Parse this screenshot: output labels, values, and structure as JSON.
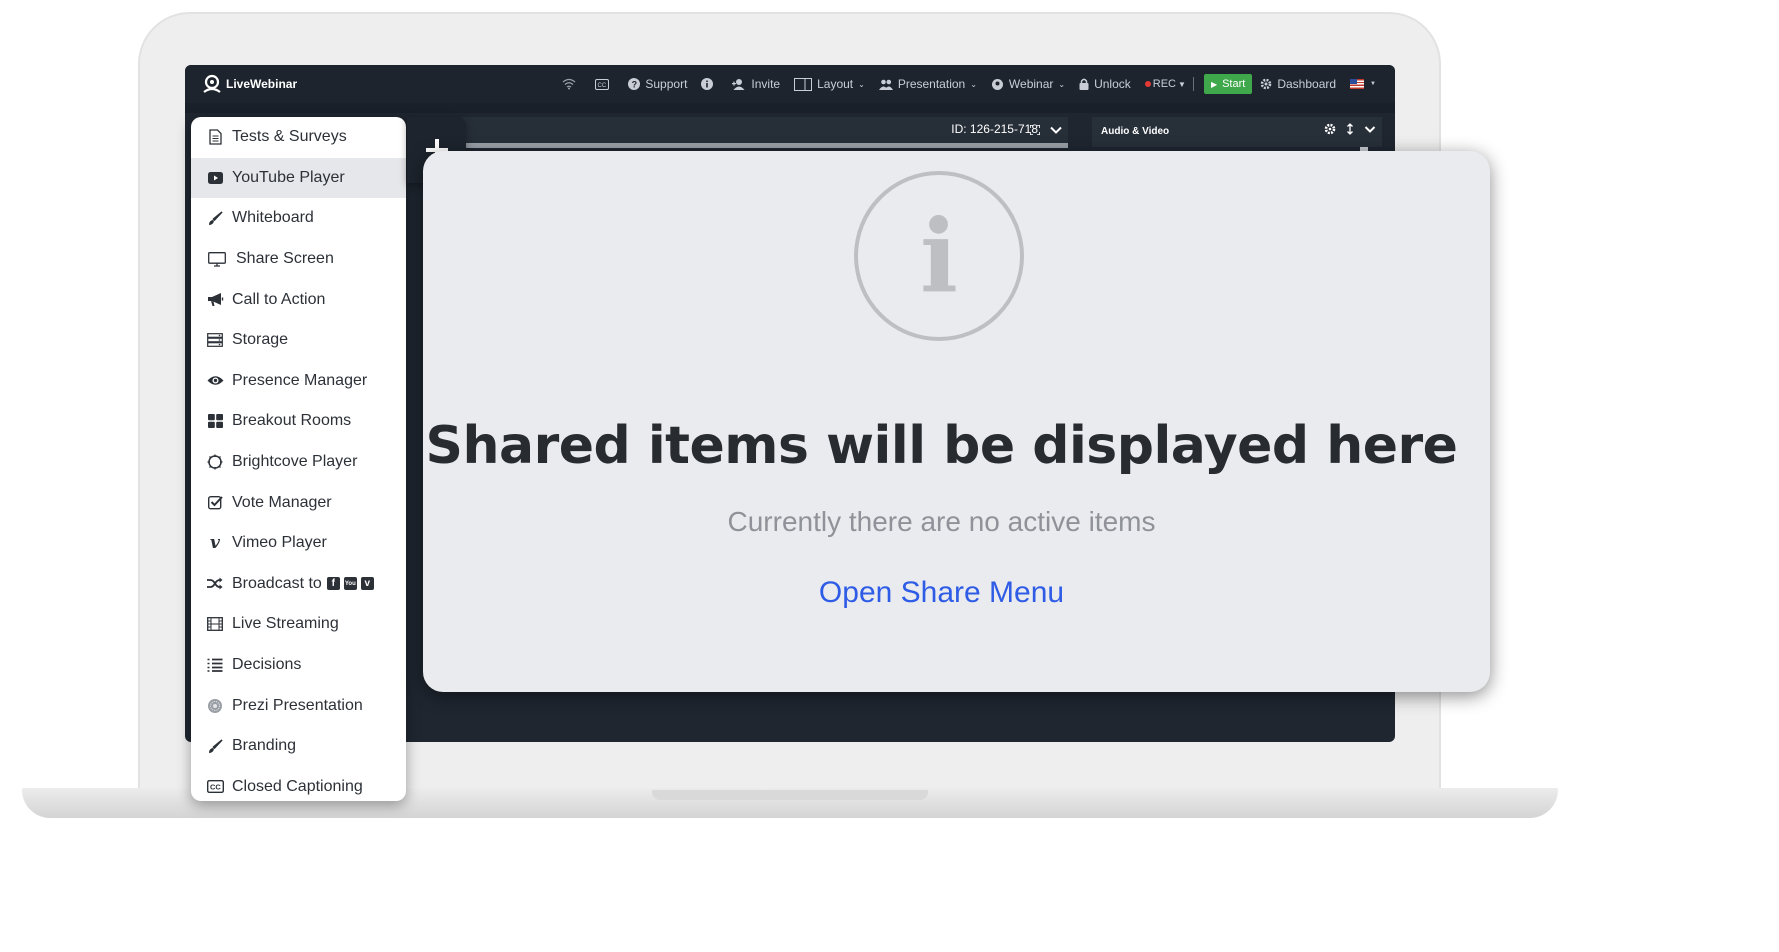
{
  "app": {
    "brand": "LiveWebinar"
  },
  "topbar": {
    "support": "Support",
    "invite": "Invite",
    "layout": "Layout",
    "presentation": "Presentation",
    "webinar": "Webinar",
    "unlock": "Unlock",
    "rec": "REC",
    "start": "Start",
    "dashboard": "Dashboard"
  },
  "stage": {
    "id_label": "ID: 126-215-718"
  },
  "av_panel": {
    "title": "Audio & Video"
  },
  "share_menu": {
    "items": [
      {
        "label": "Tests & Surveys",
        "icon": "document-icon"
      },
      {
        "label": "YouTube Player",
        "icon": "youtube-icon"
      },
      {
        "label": "Whiteboard",
        "icon": "brush-icon"
      },
      {
        "label": "Share Screen",
        "icon": "monitor-icon"
      },
      {
        "label": "Call to Action",
        "icon": "megaphone-icon"
      },
      {
        "label": "Storage",
        "icon": "storage-icon"
      },
      {
        "label": "Presence Manager",
        "icon": "eye-icon"
      },
      {
        "label": "Breakout Rooms",
        "icon": "grid-icon"
      },
      {
        "label": "Brightcove Player",
        "icon": "circle-icon"
      },
      {
        "label": "Vote Manager",
        "icon": "checkbox-icon"
      },
      {
        "label": "Vimeo Player",
        "icon": "vimeo-icon"
      },
      {
        "label": "Broadcast to",
        "icon": "shuffle-icon"
      },
      {
        "label": "Live Streaming",
        "icon": "film-icon"
      },
      {
        "label": "Decisions",
        "icon": "list-icon"
      },
      {
        "label": "Prezi Presentation",
        "icon": "prezi-icon"
      },
      {
        "label": "Branding",
        "icon": "brush-icon"
      },
      {
        "label": "Closed Captioning",
        "icon": "cc-icon"
      }
    ],
    "active_index": 1
  },
  "card": {
    "title": "Shared items will be displayed here",
    "subtitle": "Currently there are no active items",
    "link": "Open Share Menu"
  },
  "colors": {
    "accent_link": "#2f5ce6",
    "start_green": "#3fa84a",
    "dark_bar": "#1d242d"
  }
}
